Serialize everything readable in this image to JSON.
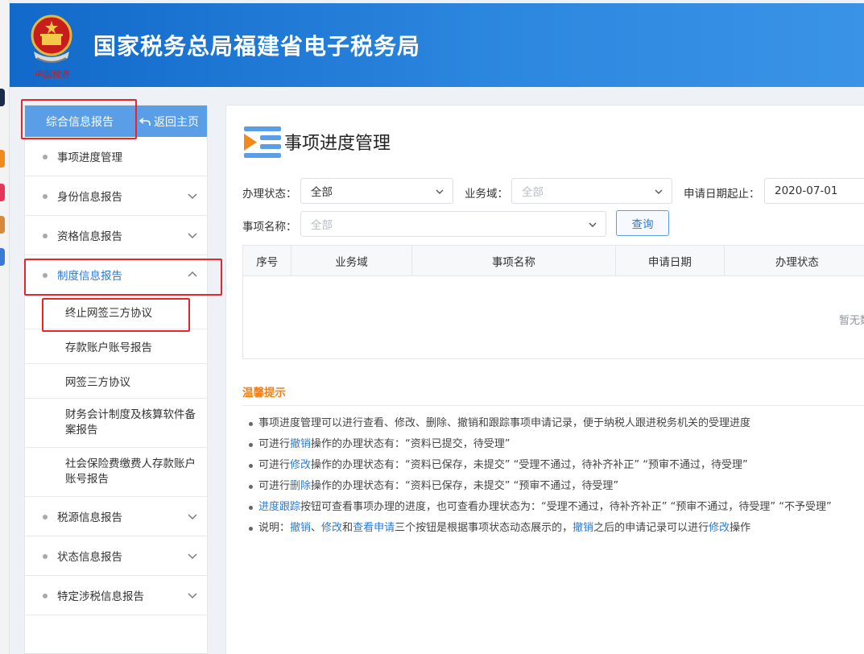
{
  "header": {
    "title": "国家税务总局福建省电子税务局",
    "logo_text": "中国税务"
  },
  "sidebar": {
    "report_tab": "综合信息报告",
    "home_link": "返回主页",
    "items": [
      {
        "label": "事项进度管理",
        "expandable": false
      },
      {
        "label": "身份信息报告",
        "expandable": true
      },
      {
        "label": "资格信息报告",
        "expandable": true
      },
      {
        "label": "制度信息报告",
        "expandable": true,
        "expanded": true,
        "children": [
          "终止网签三方协议",
          "存款账户账号报告",
          "网签三方协议",
          "财务会计制度及核算软件备案报告",
          "社会保险费缴费人存款账户账号报告"
        ]
      },
      {
        "label": "税源信息报告",
        "expandable": true
      },
      {
        "label": "状态信息报告",
        "expandable": true
      },
      {
        "label": "特定涉税信息报告",
        "expandable": true
      }
    ]
  },
  "main": {
    "title": "事项进度管理",
    "filters": {
      "status_label": "办理状态：",
      "status_value": "全部",
      "domain_label": "业务域：",
      "domain_placeholder": "全部",
      "date_label": "申请日期起止：",
      "date_value": "2020-07-01",
      "item_label": "事项名称：",
      "item_placeholder": "全部",
      "query_button": "查询"
    },
    "table": {
      "columns": [
        "序号",
        "业务域",
        "事项名称",
        "申请日期",
        "办理状态"
      ],
      "empty_text": "暂无数据"
    },
    "tips": {
      "title": "温馨提示",
      "lines": [
        [
          {
            "t": "事项进度管理可以进行查看、修改、删除、撤销和跟踪事项申请记录，便于纳税人跟进税务机关的受理进度"
          }
        ],
        [
          {
            "t": "可进行"
          },
          {
            "t": "撤销",
            "link": true
          },
          {
            "t": "操作的办理状态有：“资料已提交，待受理”"
          }
        ],
        [
          {
            "t": "可进行"
          },
          {
            "t": "修改",
            "link": true
          },
          {
            "t": "操作的办理状态有：“资料已保存，未提交”  “受理不通过，待补齐补正”  “预审不通过，待受理”"
          }
        ],
        [
          {
            "t": "可进行"
          },
          {
            "t": "删除",
            "link": true
          },
          {
            "t": "操作的办理状态有：“资料已保存，未提交”  “预审不通过，待受理”"
          }
        ],
        [
          {
            "t": "进度跟踪",
            "link": true
          },
          {
            "t": "按钮可查看事项办理的进度，也可查看办理状态为：“受理不通过，待补齐补正”  “预审不通过，待受理”  “不予受理”"
          }
        ],
        [
          {
            "t": "说明："
          },
          {
            "t": "撤销",
            "link": true
          },
          {
            "t": "、"
          },
          {
            "t": "修改",
            "link": true
          },
          {
            "t": "和"
          },
          {
            "t": "查看申请",
            "link": true
          },
          {
            "t": "三个按钮是根据事项状态动态展示的，"
          },
          {
            "t": "撤销",
            "link": true
          },
          {
            "t": "之后的申请记录可以进行"
          },
          {
            "t": "修改",
            "link": true
          },
          {
            "t": "操作"
          }
        ]
      ]
    }
  },
  "colors": {
    "header": "#2b86de",
    "accent": "#2b7ad4",
    "tip_title": "#f0801a",
    "annotation": "#e8262a"
  }
}
